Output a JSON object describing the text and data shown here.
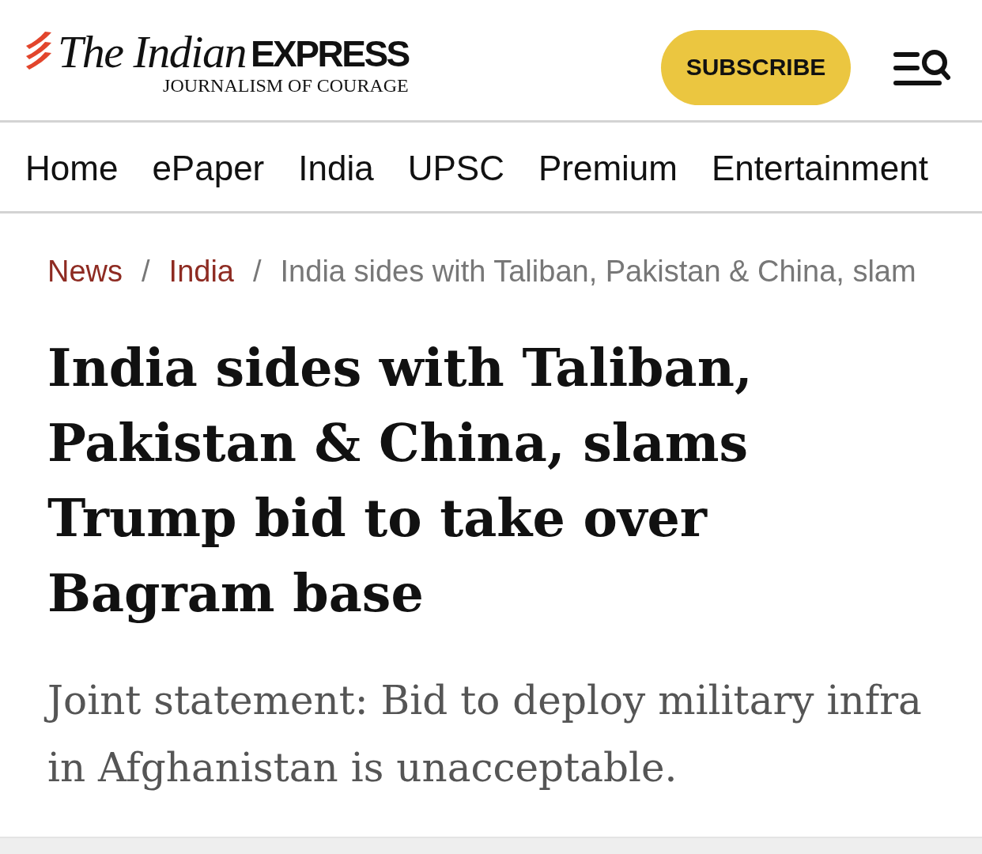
{
  "header": {
    "logo": {
      "title": "The Indian",
      "title_emphasis": "EXPRESS",
      "tagline": "JOURNALISM OF COURAGE"
    },
    "subscribe_button": "SUBSCRIBE"
  },
  "nav": {
    "items": [
      {
        "label": "Home"
      },
      {
        "label": "ePaper"
      },
      {
        "label": "India"
      },
      {
        "label": "UPSC"
      },
      {
        "label": "Premium"
      },
      {
        "label": "Entertainment"
      }
    ]
  },
  "breadcrumb": [
    {
      "kind": "link",
      "label": "News"
    },
    {
      "kind": "separator",
      "label": "/"
    },
    {
      "kind": "link",
      "label": "India"
    },
    {
      "kind": "separator",
      "label": "/"
    },
    {
      "kind": "current",
      "label": "India sides with Taliban, Pakistan & China, slam"
    }
  ],
  "article": {
    "headline": "India sides with Taliban, Pakistan & China, slams Trump bid to take over Bagram base",
    "standfirst": "Joint statement: Bid to deploy military infra in Afghanistan is unacceptable."
  }
}
